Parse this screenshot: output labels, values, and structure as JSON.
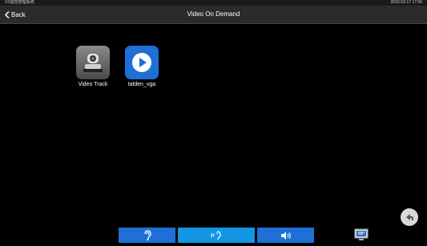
{
  "status_bar": {
    "left_text": "XX监控管理系统",
    "right_text": "2023-03-17 17:56"
  },
  "header": {
    "back_label": "Back",
    "title": "Video On Demand"
  },
  "apps": [
    {
      "label": "Video Track",
      "icon": "camera-icon"
    },
    {
      "label": "talden_vga",
      "icon": "play-icon"
    }
  ],
  "bottom_bar": {
    "tabs": [
      {
        "icon": "ear-icon",
        "active": false
      },
      {
        "icon": "talk-icon",
        "active": true
      },
      {
        "icon": "speaker-icon",
        "active": false
      }
    ],
    "screen_icon": "monitor-icon"
  },
  "return_icon": "return-icon",
  "colors": {
    "accent": "#1f6fd6",
    "active_tab": "#1296e4",
    "header_bg": "#2b2b2b",
    "background": "#000000"
  }
}
